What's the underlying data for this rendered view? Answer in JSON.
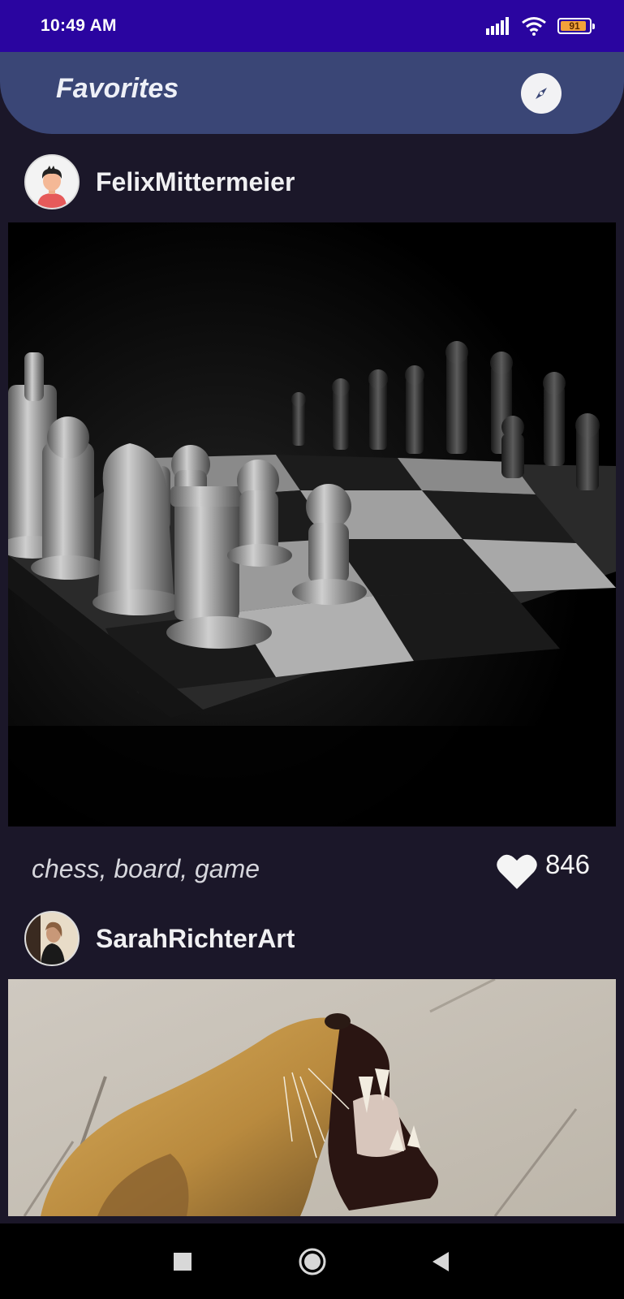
{
  "status_bar": {
    "time": "10:49 AM",
    "battery_level": "91",
    "icons": [
      "signal-icon",
      "wifi-icon",
      "battery-icon"
    ]
  },
  "app_bar": {
    "title": "Favorites",
    "action_icon": "compass-icon"
  },
  "posts": [
    {
      "username": "FelixMittermeier",
      "image_icon": "chess-photo",
      "tags": "chess, board, game",
      "likes": "846"
    },
    {
      "username": "SarahRichterArt",
      "image_icon": "lion-photo"
    }
  ],
  "nav_bar": {
    "items": [
      "recents-icon",
      "home-icon",
      "back-icon"
    ]
  },
  "colors": {
    "status_bar": "#2a05a0",
    "app_bar": "#3a4676",
    "background": "#1b1729"
  }
}
